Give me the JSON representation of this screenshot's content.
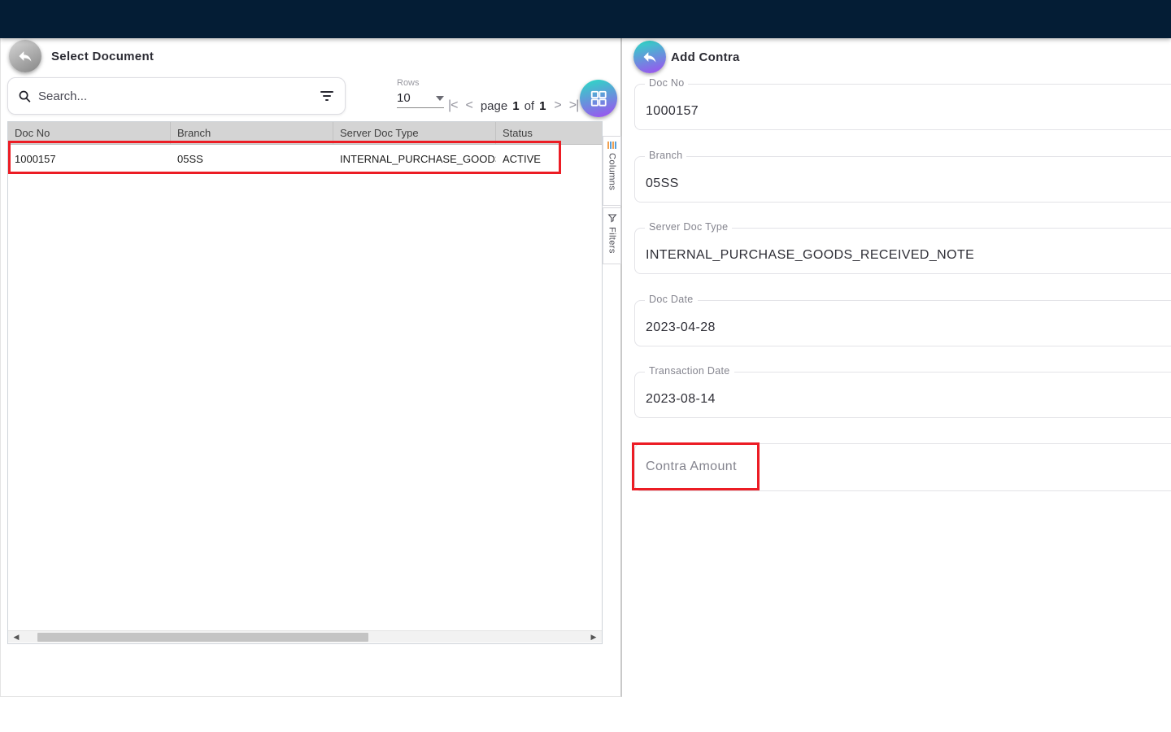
{
  "left_panel": {
    "title": "Select Document",
    "search": {
      "placeholder": "Search..."
    },
    "rows_control": {
      "label": "Rows",
      "value": "10"
    },
    "pagination": {
      "first": "|<",
      "prev": "<",
      "page_word": "page",
      "current_page": "1",
      "of_word": "of",
      "total_pages": "1",
      "next": ">",
      "last": ">|"
    },
    "side_tabs": {
      "columns": "Columns",
      "filters": "Filters"
    },
    "table": {
      "headers": [
        "Doc No",
        "Branch",
        "Server Doc Type",
        "Status"
      ],
      "rows": [
        {
          "doc_no": "1000157",
          "branch": "05SS",
          "server_doc_type": "INTERNAL_PURCHASE_GOODS...",
          "status": "ACTIVE"
        }
      ]
    }
  },
  "right_panel": {
    "title": "Add Contra",
    "fields": [
      {
        "label": "Doc No",
        "value": "1000157"
      },
      {
        "label": "Branch",
        "value": "05SS"
      },
      {
        "label": "Server Doc Type",
        "value": "INTERNAL_PURCHASE_GOODS_RECEIVED_NOTE"
      },
      {
        "label": "Doc Date",
        "value": "2023-04-28"
      },
      {
        "label": "Transaction Date",
        "value": "2023-08-14"
      },
      {
        "label": "Contra Amount",
        "value": ""
      }
    ]
  },
  "colors": {
    "topbar": "#041d35",
    "accent_gradient_start": "#2fd6c6",
    "accent_gradient_end": "#9c53f0",
    "annotation_red": "#ec1c24",
    "table_header_bg": "#d4d4d4"
  }
}
